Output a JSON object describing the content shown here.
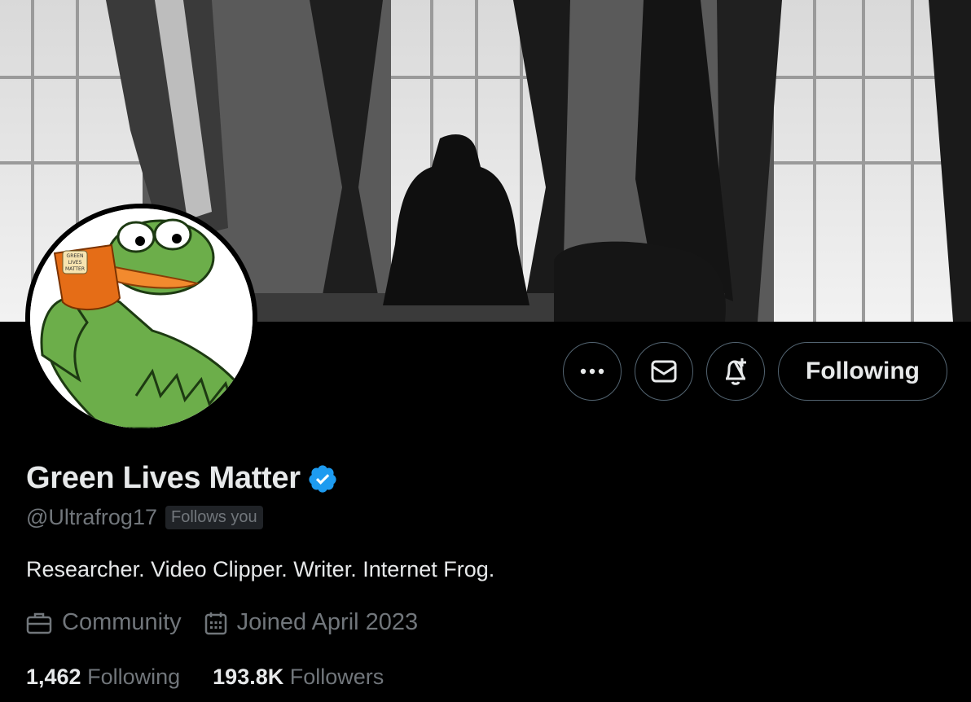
{
  "profile": {
    "display_name": "Green Lives Matter",
    "handle": "@Ultrafrog17",
    "follows_you": "Follows you",
    "bio": "Researcher. Video Clipper. Writer. Internet Frog.",
    "category": "Community",
    "joined": "Joined April 2023",
    "following_count": "1,462",
    "following_label": "Following",
    "followers_count": "193.8K",
    "followers_label": "Followers",
    "avatar_mug_text": [
      "GREEN",
      "LIVES",
      "MATTER"
    ]
  },
  "actions": {
    "more": "more-icon",
    "message": "mail-icon",
    "notify": "bell-plus-icon",
    "follow_label": "Following"
  },
  "colors": {
    "background": "#000000",
    "primary_text": "#e7e9ea",
    "secondary_text": "#71767b",
    "border": "#536471",
    "verified": "#1d9bf0"
  }
}
